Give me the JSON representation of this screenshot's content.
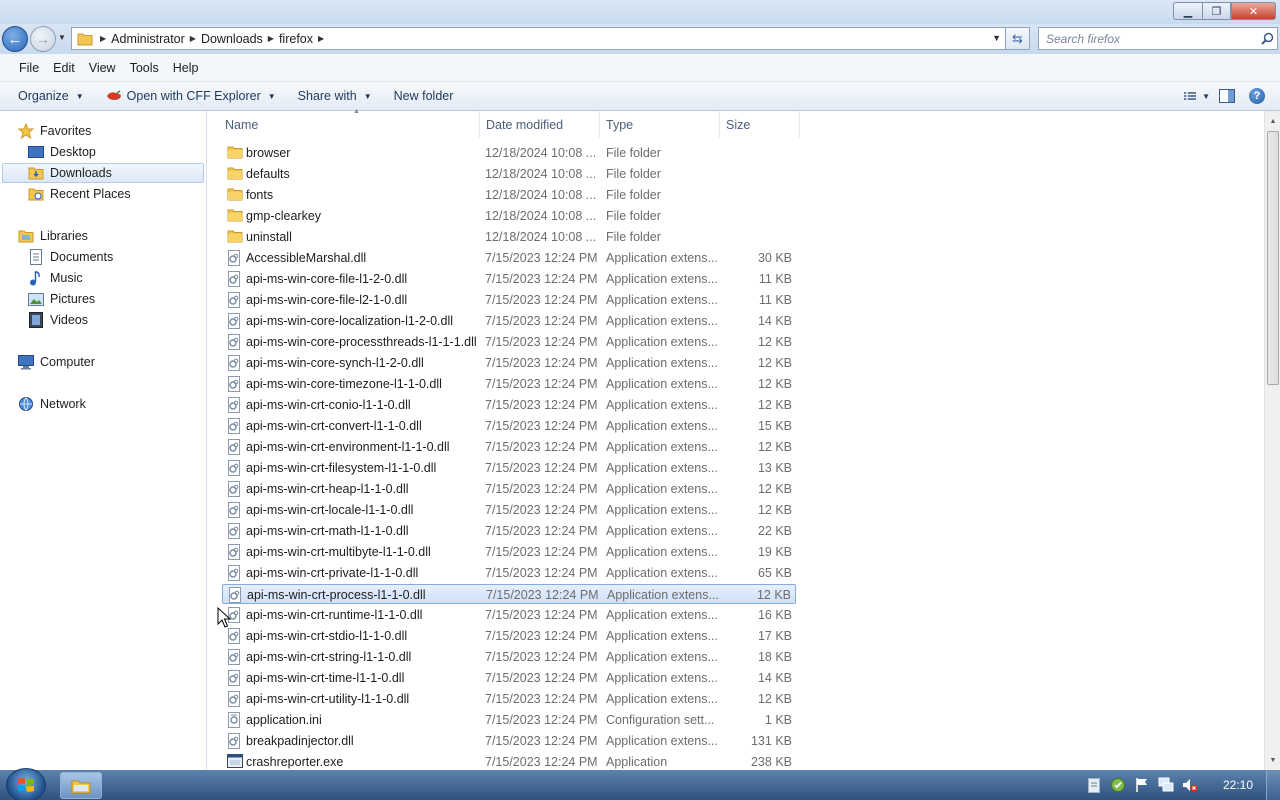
{
  "window": {
    "minimize_glyph": "▁",
    "maximize_glyph": "❐",
    "close_glyph": "✕"
  },
  "address": {
    "crumbs": [
      "Administrator",
      "Downloads",
      "firefox"
    ],
    "search_placeholder": "Search firefox"
  },
  "menu": [
    "File",
    "Edit",
    "View",
    "Tools",
    "Help"
  ],
  "commands": {
    "organize": "Organize",
    "open_with": "Open with CFF Explorer",
    "share_with": "Share with",
    "new_folder": "New folder"
  },
  "nav": {
    "favorites": "Favorites",
    "desktop": "Desktop",
    "downloads": "Downloads",
    "recent": "Recent Places",
    "libraries": "Libraries",
    "documents": "Documents",
    "music": "Music",
    "pictures": "Pictures",
    "videos": "Videos",
    "computer": "Computer",
    "network": "Network"
  },
  "columns": {
    "name": "Name",
    "date": "Date modified",
    "type": "Type",
    "size": "Size"
  },
  "files": [
    {
      "name": "browser",
      "date": "12/18/2024 10:08 ...",
      "type": "File folder",
      "size": "",
      "icon": "folder"
    },
    {
      "name": "defaults",
      "date": "12/18/2024 10:08 ...",
      "type": "File folder",
      "size": "",
      "icon": "folder"
    },
    {
      "name": "fonts",
      "date": "12/18/2024 10:08 ...",
      "type": "File folder",
      "size": "",
      "icon": "folder"
    },
    {
      "name": "gmp-clearkey",
      "date": "12/18/2024 10:08 ...",
      "type": "File folder",
      "size": "",
      "icon": "folder"
    },
    {
      "name": "uninstall",
      "date": "12/18/2024 10:08 ...",
      "type": "File folder",
      "size": "",
      "icon": "folder"
    },
    {
      "name": "AccessibleMarshal.dll",
      "date": "7/15/2023 12:24 PM",
      "type": "Application extens...",
      "size": "30 KB",
      "icon": "dll"
    },
    {
      "name": "api-ms-win-core-file-l1-2-0.dll",
      "date": "7/15/2023 12:24 PM",
      "type": "Application extens...",
      "size": "11 KB",
      "icon": "dll"
    },
    {
      "name": "api-ms-win-core-file-l2-1-0.dll",
      "date": "7/15/2023 12:24 PM",
      "type": "Application extens...",
      "size": "11 KB",
      "icon": "dll"
    },
    {
      "name": "api-ms-win-core-localization-l1-2-0.dll",
      "date": "7/15/2023 12:24 PM",
      "type": "Application extens...",
      "size": "14 KB",
      "icon": "dll"
    },
    {
      "name": "api-ms-win-core-processthreads-l1-1-1.dll",
      "date": "7/15/2023 12:24 PM",
      "type": "Application extens...",
      "size": "12 KB",
      "icon": "dll"
    },
    {
      "name": "api-ms-win-core-synch-l1-2-0.dll",
      "date": "7/15/2023 12:24 PM",
      "type": "Application extens...",
      "size": "12 KB",
      "icon": "dll"
    },
    {
      "name": "api-ms-win-core-timezone-l1-1-0.dll",
      "date": "7/15/2023 12:24 PM",
      "type": "Application extens...",
      "size": "12 KB",
      "icon": "dll"
    },
    {
      "name": "api-ms-win-crt-conio-l1-1-0.dll",
      "date": "7/15/2023 12:24 PM",
      "type": "Application extens...",
      "size": "12 KB",
      "icon": "dll"
    },
    {
      "name": "api-ms-win-crt-convert-l1-1-0.dll",
      "date": "7/15/2023 12:24 PM",
      "type": "Application extens...",
      "size": "15 KB",
      "icon": "dll"
    },
    {
      "name": "api-ms-win-crt-environment-l1-1-0.dll",
      "date": "7/15/2023 12:24 PM",
      "type": "Application extens...",
      "size": "12 KB",
      "icon": "dll"
    },
    {
      "name": "api-ms-win-crt-filesystem-l1-1-0.dll",
      "date": "7/15/2023 12:24 PM",
      "type": "Application extens...",
      "size": "13 KB",
      "icon": "dll"
    },
    {
      "name": "api-ms-win-crt-heap-l1-1-0.dll",
      "date": "7/15/2023 12:24 PM",
      "type": "Application extens...",
      "size": "12 KB",
      "icon": "dll"
    },
    {
      "name": "api-ms-win-crt-locale-l1-1-0.dll",
      "date": "7/15/2023 12:24 PM",
      "type": "Application extens...",
      "size": "12 KB",
      "icon": "dll"
    },
    {
      "name": "api-ms-win-crt-math-l1-1-0.dll",
      "date": "7/15/2023 12:24 PM",
      "type": "Application extens...",
      "size": "22 KB",
      "icon": "dll"
    },
    {
      "name": "api-ms-win-crt-multibyte-l1-1-0.dll",
      "date": "7/15/2023 12:24 PM",
      "type": "Application extens...",
      "size": "19 KB",
      "icon": "dll"
    },
    {
      "name": "api-ms-win-crt-private-l1-1-0.dll",
      "date": "7/15/2023 12:24 PM",
      "type": "Application extens...",
      "size": "65 KB",
      "icon": "dll"
    },
    {
      "name": "api-ms-win-crt-process-l1-1-0.dll",
      "date": "7/15/2023 12:24 PM",
      "type": "Application extens...",
      "size": "12 KB",
      "icon": "dll",
      "selected": true
    },
    {
      "name": "api-ms-win-crt-runtime-l1-1-0.dll",
      "date": "7/15/2023 12:24 PM",
      "type": "Application extens...",
      "size": "16 KB",
      "icon": "dll"
    },
    {
      "name": "api-ms-win-crt-stdio-l1-1-0.dll",
      "date": "7/15/2023 12:24 PM",
      "type": "Application extens...",
      "size": "17 KB",
      "icon": "dll"
    },
    {
      "name": "api-ms-win-crt-string-l1-1-0.dll",
      "date": "7/15/2023 12:24 PM",
      "type": "Application extens...",
      "size": "18 KB",
      "icon": "dll"
    },
    {
      "name": "api-ms-win-crt-time-l1-1-0.dll",
      "date": "7/15/2023 12:24 PM",
      "type": "Application extens...",
      "size": "14 KB",
      "icon": "dll"
    },
    {
      "name": "api-ms-win-crt-utility-l1-1-0.dll",
      "date": "7/15/2023 12:24 PM",
      "type": "Application extens...",
      "size": "12 KB",
      "icon": "dll"
    },
    {
      "name": "application.ini",
      "date": "7/15/2023 12:24 PM",
      "type": "Configuration sett...",
      "size": "1 KB",
      "icon": "ini"
    },
    {
      "name": "breakpadinjector.dll",
      "date": "7/15/2023 12:24 PM",
      "type": "Application extens...",
      "size": "131 KB",
      "icon": "dll"
    },
    {
      "name": "crashreporter.exe",
      "date": "7/15/2023 12:24 PM",
      "type": "Application",
      "size": "238 KB",
      "icon": "exe"
    }
  ],
  "taskbar": {
    "clock": "22:10"
  },
  "colors": {
    "selection": "#cfe2f9",
    "folder": "#f2c650",
    "accent": "#1f5aa8"
  }
}
